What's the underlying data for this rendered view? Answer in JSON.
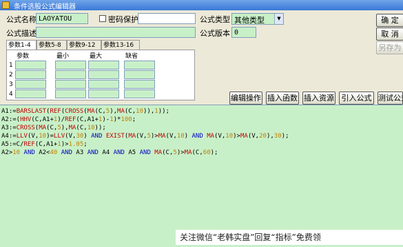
{
  "window": {
    "title": "条件选股公式编辑器"
  },
  "form": {
    "name_label": "公式名称",
    "name_value": "LAOYATOU",
    "password_label": "密码保护",
    "password_checked": false,
    "type_label": "公式类型",
    "type_value": "其他类型",
    "desc_label": "公式描述",
    "desc_value": "",
    "version_label": "公式版本",
    "version_value": "0"
  },
  "buttons": {
    "ok": "确  定",
    "cancel": "取  消",
    "save_as": "另存为",
    "edit_op": "编辑操作",
    "insert_func": "插入函数",
    "insert_resource": "插入资源",
    "import": "引入公式",
    "test": "测试公式"
  },
  "tabs": [
    "参数1-4",
    "参数5-8",
    "参数9-12",
    "参数13-16"
  ],
  "params": {
    "headers": [
      "参数",
      "最小",
      "最大",
      "缺省"
    ],
    "rows": [
      "1",
      "2",
      "3",
      "4"
    ]
  },
  "formula": {
    "lines": [
      [
        {
          "t": "A1:=",
          "c": ""
        },
        {
          "t": "BARSLAST",
          "c": "fn"
        },
        {
          "t": "(",
          "c": ""
        },
        {
          "t": "REF",
          "c": "fn"
        },
        {
          "t": "(",
          "c": ""
        },
        {
          "t": "CROSS",
          "c": "fn"
        },
        {
          "t": "(",
          "c": ""
        },
        {
          "t": "MA",
          "c": "fn"
        },
        {
          "t": "(C,",
          "c": ""
        },
        {
          "t": "5",
          "c": "num"
        },
        {
          "t": "),",
          "c": ""
        },
        {
          "t": "MA",
          "c": "fn"
        },
        {
          "t": "(C,",
          "c": ""
        },
        {
          "t": "10",
          "c": "num"
        },
        {
          "t": ")),",
          "c": ""
        },
        {
          "t": "1",
          "c": "num"
        },
        {
          "t": "));",
          "c": ""
        }
      ],
      [
        {
          "t": "A2:=(",
          "c": ""
        },
        {
          "t": "HHV",
          "c": "fn"
        },
        {
          "t": "(C,A1+",
          "c": ""
        },
        {
          "t": "1",
          "c": "num"
        },
        {
          "t": ")/",
          "c": ""
        },
        {
          "t": "REF",
          "c": "fn"
        },
        {
          "t": "(C,A1+",
          "c": ""
        },
        {
          "t": "1",
          "c": "num"
        },
        {
          "t": ")-",
          "c": ""
        },
        {
          "t": "1",
          "c": "num"
        },
        {
          "t": ")*",
          "c": ""
        },
        {
          "t": "100",
          "c": "num"
        },
        {
          "t": ";",
          "c": ""
        }
      ],
      [
        {
          "t": "A3:=",
          "c": ""
        },
        {
          "t": "CROSS",
          "c": "fn"
        },
        {
          "t": "(",
          "c": ""
        },
        {
          "t": "MA",
          "c": "fn"
        },
        {
          "t": "(C,",
          "c": ""
        },
        {
          "t": "5",
          "c": "num"
        },
        {
          "t": "),",
          "c": ""
        },
        {
          "t": "MA",
          "c": "fn"
        },
        {
          "t": "(C,",
          "c": ""
        },
        {
          "t": "10",
          "c": "num"
        },
        {
          "t": "));",
          "c": ""
        }
      ],
      [
        {
          "t": "A4:=",
          "c": ""
        },
        {
          "t": "LLV",
          "c": "fn"
        },
        {
          "t": "(V,",
          "c": ""
        },
        {
          "t": "10",
          "c": "num"
        },
        {
          "t": ")=",
          "c": ""
        },
        {
          "t": "LLV",
          "c": "fn"
        },
        {
          "t": "(V,",
          "c": ""
        },
        {
          "t": "30",
          "c": "num"
        },
        {
          "t": ") ",
          "c": ""
        },
        {
          "t": "AND",
          "c": "kw"
        },
        {
          "t": " ",
          "c": ""
        },
        {
          "t": "EXIST",
          "c": "fn"
        },
        {
          "t": "(",
          "c": ""
        },
        {
          "t": "MA",
          "c": "fn"
        },
        {
          "t": "(V,",
          "c": ""
        },
        {
          "t": "5",
          "c": "num"
        },
        {
          "t": ")>",
          "c": ""
        },
        {
          "t": "MA",
          "c": "fn"
        },
        {
          "t": "(V,",
          "c": ""
        },
        {
          "t": "10",
          "c": "num"
        },
        {
          "t": ") ",
          "c": ""
        },
        {
          "t": "AND",
          "c": "kw"
        },
        {
          "t": " ",
          "c": ""
        },
        {
          "t": "MA",
          "c": "fn"
        },
        {
          "t": "(V,",
          "c": ""
        },
        {
          "t": "10",
          "c": "num"
        },
        {
          "t": ")>",
          "c": ""
        },
        {
          "t": "MA",
          "c": "fn"
        },
        {
          "t": "(V,",
          "c": ""
        },
        {
          "t": "20",
          "c": "num"
        },
        {
          "t": "),",
          "c": ""
        },
        {
          "t": "30",
          "c": "num"
        },
        {
          "t": ");",
          "c": ""
        }
      ],
      [
        {
          "t": "A5:=C/",
          "c": ""
        },
        {
          "t": "REF",
          "c": "fn"
        },
        {
          "t": "(C,A1+",
          "c": ""
        },
        {
          "t": "1",
          "c": "num"
        },
        {
          "t": ")>",
          "c": ""
        },
        {
          "t": "1.05",
          "c": "num"
        },
        {
          "t": ";",
          "c": ""
        }
      ],
      [
        {
          "t": "A2>",
          "c": ""
        },
        {
          "t": "10",
          "c": "num"
        },
        {
          "t": " ",
          "c": ""
        },
        {
          "t": "AND",
          "c": "kw"
        },
        {
          "t": " A2<",
          "c": ""
        },
        {
          "t": "40",
          "c": "num"
        },
        {
          "t": " ",
          "c": ""
        },
        {
          "t": "AND",
          "c": "kw"
        },
        {
          "t": " A3 ",
          "c": ""
        },
        {
          "t": "AND",
          "c": "kw"
        },
        {
          "t": " A4 ",
          "c": ""
        },
        {
          "t": "AND",
          "c": "kw"
        },
        {
          "t": " A5 ",
          "c": ""
        },
        {
          "t": "AND",
          "c": "kw"
        },
        {
          "t": " ",
          "c": ""
        },
        {
          "t": "MA",
          "c": "fn"
        },
        {
          "t": "(C,",
          "c": ""
        },
        {
          "t": "5",
          "c": "num"
        },
        {
          "t": ")>",
          "c": ""
        },
        {
          "t": "MA",
          "c": "fn"
        },
        {
          "t": "(C,",
          "c": ""
        },
        {
          "t": "60",
          "c": "num"
        },
        {
          "t": ");",
          "c": ""
        }
      ]
    ]
  },
  "watermark": "关注微信“老韩实盘”回复“指标”免费领",
  "colors": {
    "field_bg": "#c8f0c8",
    "function": "#c00000",
    "keyword": "#0000c0",
    "number": "#c08000"
  }
}
